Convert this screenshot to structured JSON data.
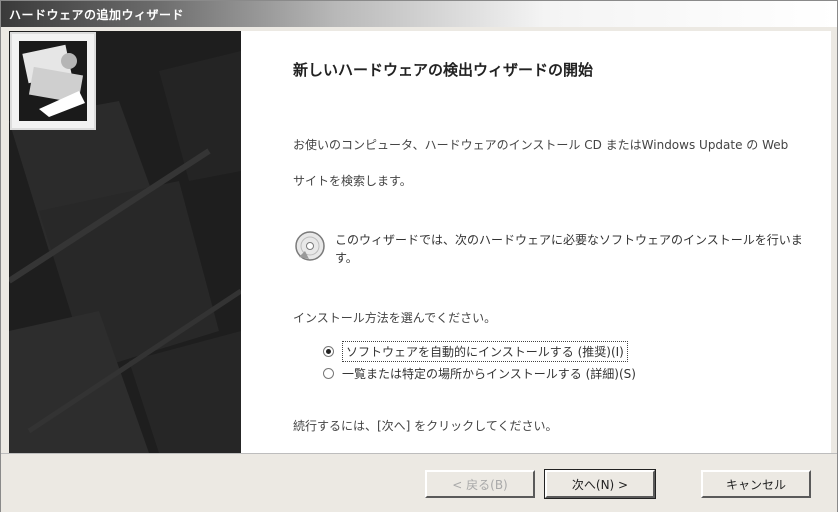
{
  "window": {
    "title": "ハードウェアの追加ウィザード"
  },
  "content": {
    "heading": "新しいハードウェアの検出ウィザードの開始",
    "paragraph": "お使いのコンピュータ、ハードウェアのインストール CD またはWindows Update の Web サイトを検索します。",
    "info_text": "このウィザードでは、次のハードウェアに必要なソフトウェアのインストールを行います。",
    "question": "インストール方法を選んでください。",
    "option_auto": "ソフトウェアを自動的にインストールする (推奨)(I)",
    "option_manual": "一覧または特定の場所からインストールする (詳細)(S)",
    "footer_note": "続行するには、[次へ] をクリックしてください。"
  },
  "buttons": {
    "back_label": "< 戻る(B)",
    "next_label": "次へ(N) >",
    "cancel_label": "キャンセル"
  },
  "icons": {
    "wizard_logo": "hardware-wizard-icon",
    "info": "cd-disc-icon"
  }
}
